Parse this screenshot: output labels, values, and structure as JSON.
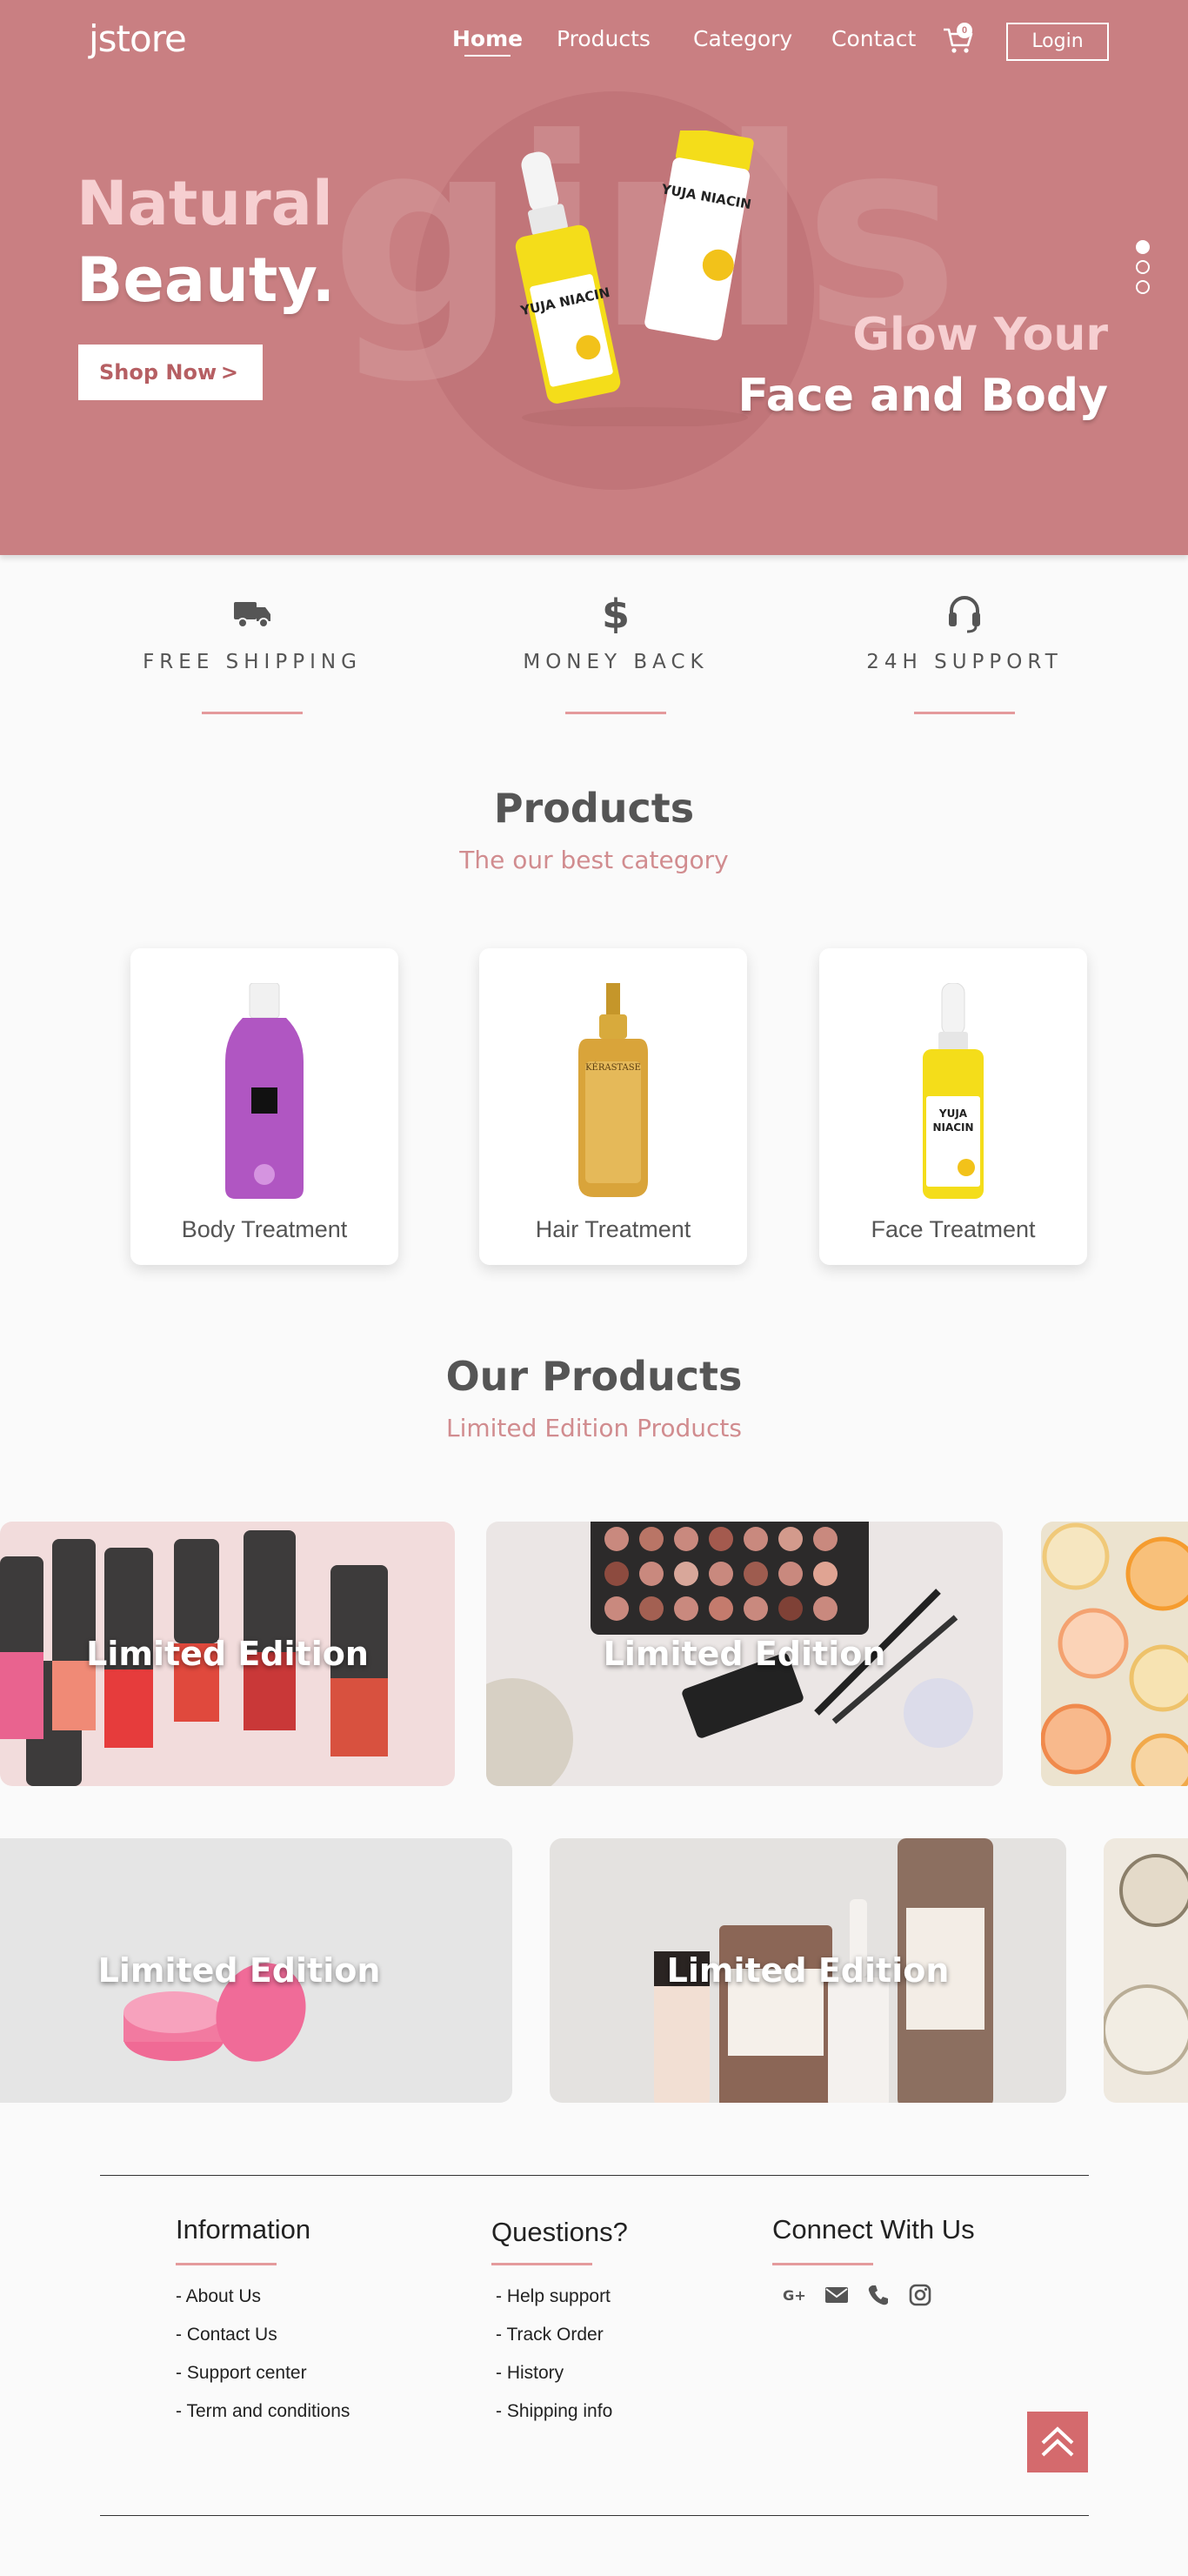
{
  "header": {
    "brand": "jstore",
    "nav": [
      "Home",
      "Products",
      "Category",
      "Contact"
    ],
    "cart_count": "0",
    "login_label": "Login"
  },
  "hero": {
    "title_line1": "Natural",
    "title_line2": "Beauty.",
    "bg_word": "girls",
    "cta_label": "Shop Now",
    "cta_chevron": ">",
    "tagline_line1": "Glow Your",
    "tagline_line2": "Face and Body",
    "product_labels": [
      "YUJA NIACIN",
      "YUJA NIACIN"
    ],
    "slides": 3,
    "active_slide": 1
  },
  "features": [
    {
      "icon": "truck-icon",
      "label": "FREE SHIPPING"
    },
    {
      "icon": "dollar-icon",
      "label": "MONEY BACK"
    },
    {
      "icon": "headset-icon",
      "label": "24H SUPPORT"
    }
  ],
  "categories_section": {
    "title": "Products",
    "subtitle": "The our best category",
    "items": [
      "Body Treatment",
      "Hair Treatment",
      "Face Treatment"
    ]
  },
  "products_section": {
    "title": "Our Products",
    "subtitle": "Limited Edition Products",
    "tile_caption": "Limited Edition"
  },
  "footer": {
    "info_title": "Information",
    "info_links": [
      "- About Us",
      "- Contact Us",
      "- Support center",
      "- Term and conditions"
    ],
    "questions_title": "Questions?",
    "question_links": [
      "- Help support",
      "- Track Order",
      "- History",
      "- Shipping info"
    ],
    "connect_title": "Connect With Us",
    "social_icons": [
      "google-plus-icon",
      "envelope-icon",
      "phone-icon",
      "instagram-icon"
    ]
  },
  "colors": {
    "brand": "#c97f82",
    "accent_line": "#e49a9c",
    "subtitle": "#d18c8f",
    "to_top": "#d46a6d"
  }
}
